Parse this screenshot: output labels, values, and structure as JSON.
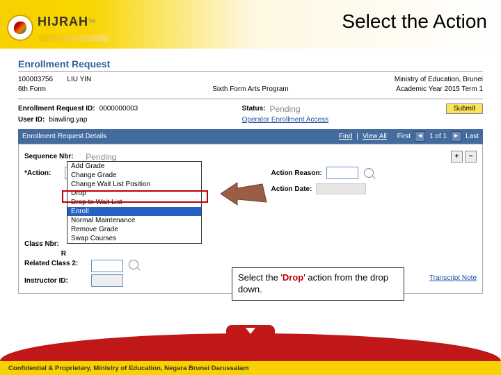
{
  "header": {
    "brand": "HIJRAH",
    "tm": "TM",
    "title": "Select the Action"
  },
  "section": {
    "heading": "Enrollment Request"
  },
  "info": {
    "id": "100003756",
    "name": "LIU YIN",
    "ministry": "Ministry of Education, Brunei",
    "form": "6th Form",
    "program": "Sixth Form Arts Program",
    "term": "Academic Year 2015 Term 1"
  },
  "req": {
    "idlbl": "Enrollment Request ID:",
    "idval": "0000000003",
    "statuslbl": "Status:",
    "statusval": "Pending",
    "userlbl": "User ID:",
    "userval": "biawling.yap",
    "accesslink": "Operator Enrollment Access",
    "submit": "Submit"
  },
  "details": {
    "title": "Enrollment Request Details",
    "find": "Find",
    "viewall": "View All",
    "first": "First",
    "pos": "1 of 1",
    "last": "Last"
  },
  "seq": {
    "seqlbl": "Sequence Nbr:",
    "seqval": "Pending",
    "plus": "+",
    "minus": "−",
    "actionlbl": "*Action:",
    "actionval": "Enroll",
    "reasonlbl": "Action Reason:",
    "datelbl": "Action Date:",
    "options": [
      "Add Grade",
      "Change Grade",
      "Change Wait List Position",
      "Drop",
      "Drop to Wait List",
      "Enroll",
      "Normal Maintenance",
      "Remove Grade",
      "Swap Courses"
    ],
    "classlbl": "Class Nbr:",
    "r": "R",
    "rel2": "Related Class 2:",
    "instructor": "Instructor ID:",
    "transcript": "Transcript Note"
  },
  "callout": {
    "t1": "Select the '",
    "t2": "Drop",
    "t3": "' action from the drop down."
  },
  "footer": "Confidential & Proprietary, Ministry of Education, Negara Brunei Darussalam"
}
